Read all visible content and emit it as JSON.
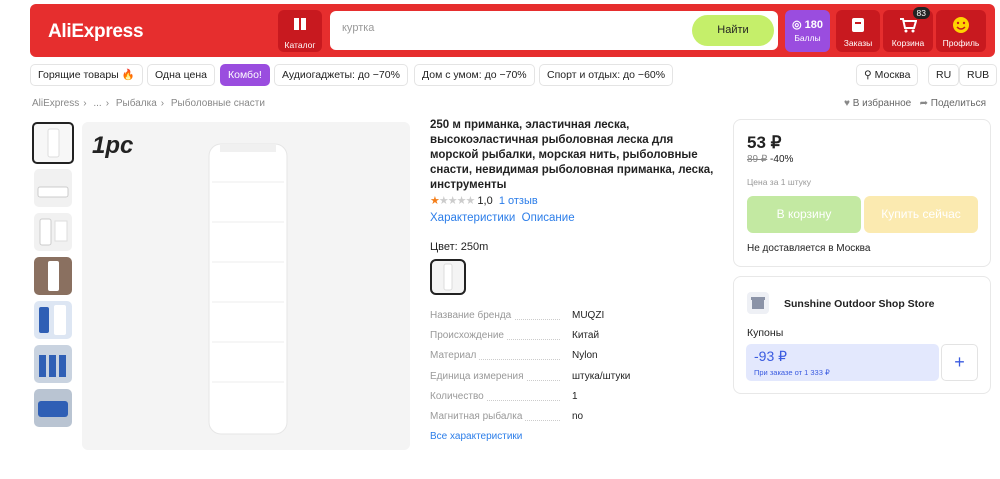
{
  "header": {
    "logo": "AliExpress",
    "catalog": "Каталог",
    "search_placeholder": "куртка",
    "search_button": "Найти",
    "points_value": "180",
    "points_label": "Баллы",
    "orders": "Заказы",
    "cart": "Корзина",
    "cart_count": "83",
    "profile": "Профиль"
  },
  "promo_pills": [
    "Горящие товары 🔥",
    "Одна цена",
    "Комбо!",
    "Аудиогаджеты: до −70%",
    "Дом с умом: до −70%",
    "Спорт и отдых: до −60%"
  ],
  "locale": {
    "city": "Москва",
    "lang": "RU",
    "currency": "RUB"
  },
  "breadcrumb": [
    "AliExpress",
    "...",
    "Рыбалка",
    "Рыболовные снасти"
  ],
  "actions": {
    "favorite": "В избранное",
    "share": "Поделиться"
  },
  "gallery": {
    "badge": "1pc"
  },
  "product": {
    "title": "250 м приманка, эластичная леска, высокоэластичная рыболовная леска для морской рыбалки, морская нить, рыболовные снасти, невидимая рыболовная приманка, леска, инструменты",
    "rating": "1,0",
    "rating_stars": 1,
    "reviews": "1 отзыв",
    "tab_specs": "Характеристики",
    "tab_desc": "Описание",
    "color_label": "Цвет: 250m",
    "specs": [
      {
        "k": "Название бренда",
        "v": "MUQZI"
      },
      {
        "k": "Происхождение",
        "v": "Китай"
      },
      {
        "k": "Материал",
        "v": "Nylon"
      },
      {
        "k": "Единица измерения",
        "v": "штука/штуки"
      },
      {
        "k": "Количество",
        "v": "1"
      },
      {
        "k": "Магнитная рыбалка",
        "v": "no"
      }
    ],
    "all_specs": "Все характеристики"
  },
  "buybox": {
    "price": "53 ₽",
    "old_price": "89 ₽",
    "discount": "-40%",
    "unit": "Цена за 1 штуку",
    "add_to_cart": "В корзину",
    "buy_now": "Купить сейчас",
    "delivery_note": "Не доставляется в Москва"
  },
  "store": {
    "name": "Sunshine Outdoor Shop Store",
    "coupons_label": "Купоны",
    "coupon_amount": "-93 ₽",
    "coupon_condition": "При заказе от 1 333 ₽",
    "add": "+"
  },
  "colors": {
    "brand_red": "#e62e2e",
    "accent_purple": "#9a4ddf",
    "find_green": "#c5ef6a",
    "link_blue": "#2b7de9"
  }
}
